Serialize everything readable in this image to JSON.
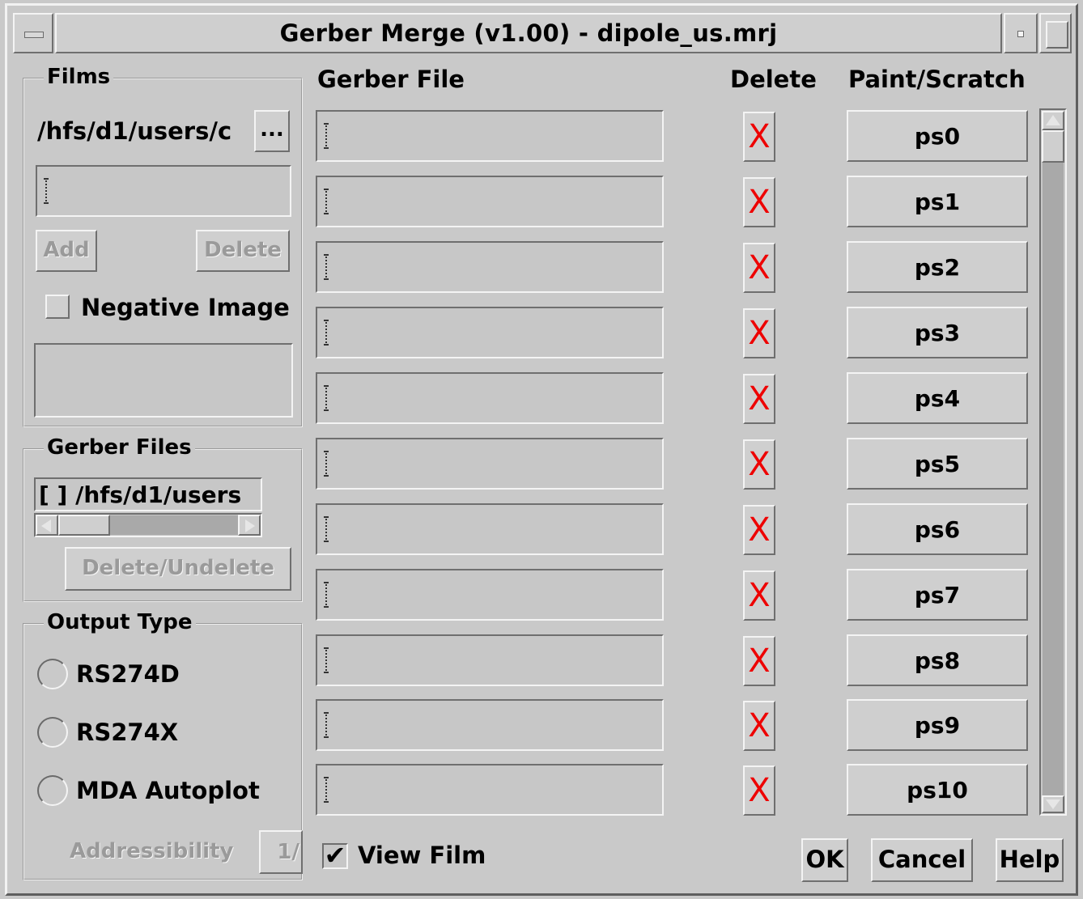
{
  "window": {
    "title": "Gerber Merge (v1.00) - dipole_us.mrj"
  },
  "films": {
    "group_title": "Films",
    "directory": "/hfs/d1/users/c",
    "browse_label": "...",
    "input_value": "",
    "add_label": "Add",
    "delete_label": "Delete",
    "negative_image_label": "Negative Image",
    "negative_image_checked": false
  },
  "gerber_files": {
    "group_title": "Gerber Files",
    "entry_text": "[ ] /hfs/d1/users",
    "delete_undelete_label": "Delete/Undelete"
  },
  "output_type": {
    "group_title": "Output Type",
    "options": [
      {
        "label": "RS274D",
        "selected": false
      },
      {
        "label": "RS274X",
        "selected": false
      },
      {
        "label": "MDA Autoplot",
        "selected": false
      }
    ],
    "addressibility_label": "Addressibility",
    "addressibility_value": "1/"
  },
  "table": {
    "headers": {
      "gerber_file": "Gerber File",
      "delete": "Delete",
      "paint_scratch": "Paint/Scratch"
    },
    "rows": [
      {
        "file": "",
        "delete_mark": "X",
        "ps_label": "ps0"
      },
      {
        "file": "",
        "delete_mark": "X",
        "ps_label": "ps1"
      },
      {
        "file": "",
        "delete_mark": "X",
        "ps_label": "ps2"
      },
      {
        "file": "",
        "delete_mark": "X",
        "ps_label": "ps3"
      },
      {
        "file": "",
        "delete_mark": "X",
        "ps_label": "ps4"
      },
      {
        "file": "",
        "delete_mark": "X",
        "ps_label": "ps5"
      },
      {
        "file": "",
        "delete_mark": "X",
        "ps_label": "ps6"
      },
      {
        "file": "",
        "delete_mark": "X",
        "ps_label": "ps7"
      },
      {
        "file": "",
        "delete_mark": "X",
        "ps_label": "ps8"
      },
      {
        "file": "",
        "delete_mark": "X",
        "ps_label": "ps9"
      },
      {
        "file": "",
        "delete_mark": "X",
        "ps_label": "ps10"
      }
    ]
  },
  "view_film": {
    "label": "View Film",
    "checked": true,
    "check_glyph": "✔"
  },
  "dialog_buttons": {
    "ok": "OK",
    "cancel": "Cancel",
    "help": "Help"
  },
  "colors": {
    "background": "#c9c9c9",
    "delete_mark": "#ee0000",
    "scroll_trough": "#a9a9a9",
    "disabled_text": "#9a9a9a"
  },
  "icons": {
    "window_menu": "window-menu-icon",
    "minimize": "minimize-icon",
    "maximize": "maximize-icon",
    "delete_toggle": "red-x-icon",
    "radio": "radio-icon",
    "checkbox": "checkbox-icon"
  }
}
